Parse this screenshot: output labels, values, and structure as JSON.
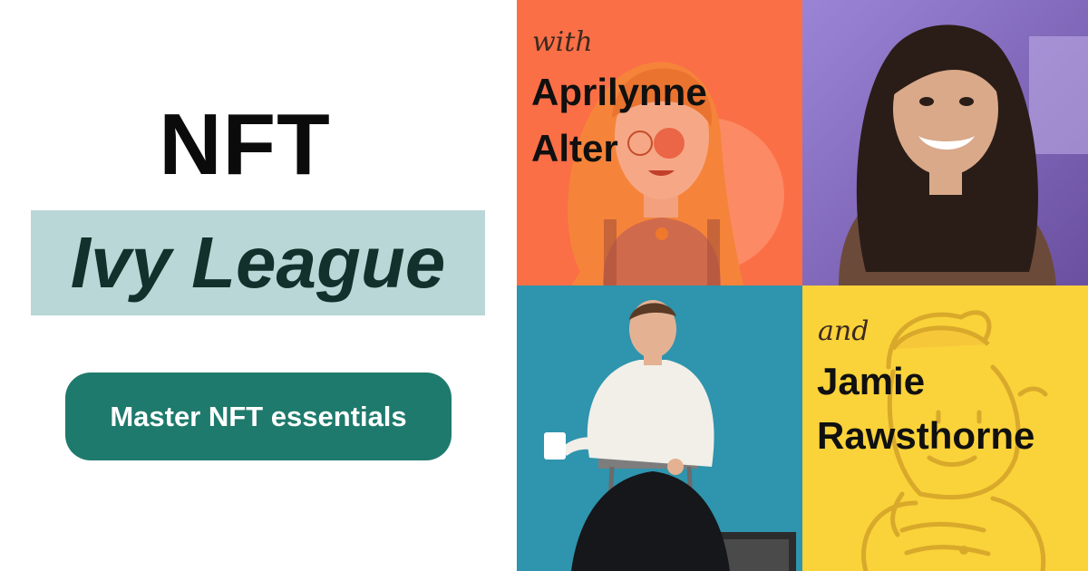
{
  "headline": {
    "line1": "NFT",
    "line2": "Ivy League"
  },
  "cta": {
    "label": "Master NFT essentials"
  },
  "host1": {
    "kicker": "with",
    "first": "Aprilynne",
    "last": "Alter"
  },
  "host2": {
    "kicker": "and",
    "first": "Jamie",
    "last": "Rawsthorne"
  },
  "colors": {
    "cta": "#1e7a6c",
    "highlight": "#b9d7d6",
    "orange_tile": "#fb6f47",
    "yellow_tile": "#fad23a",
    "blue_tile": "#2e93ad",
    "purple_tile": "#7b62b0"
  }
}
